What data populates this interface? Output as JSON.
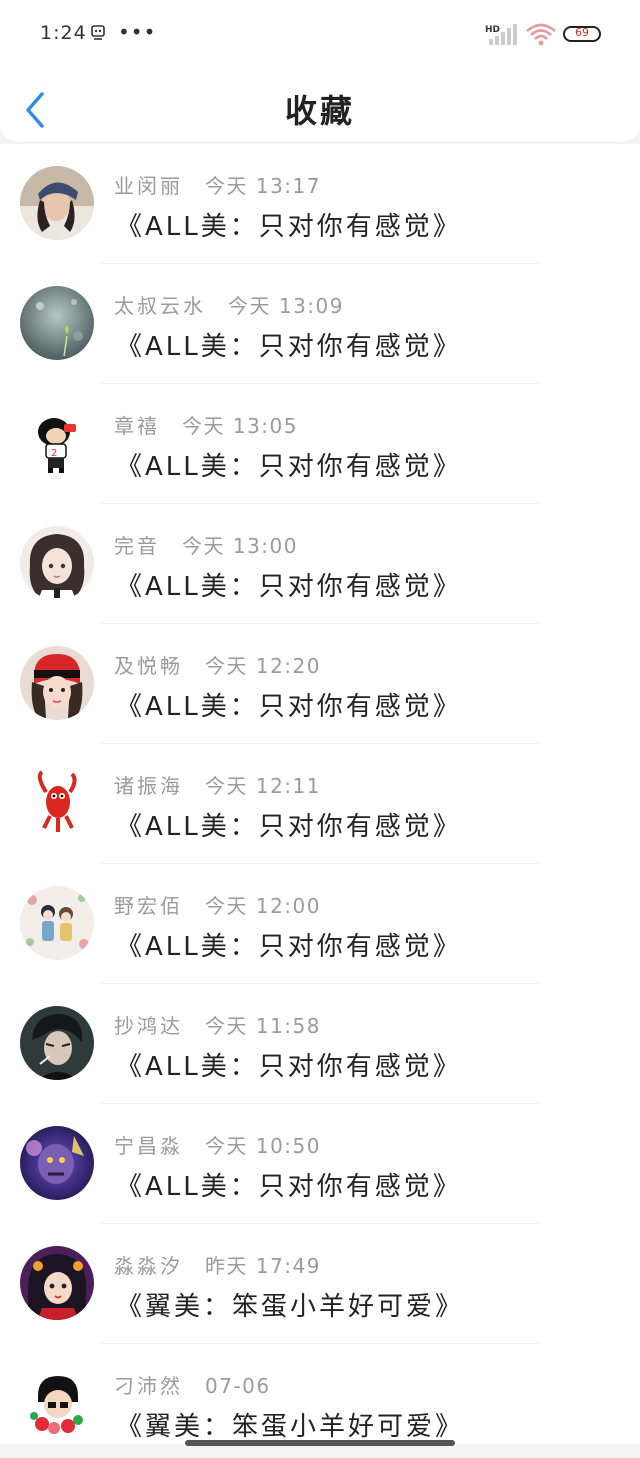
{
  "status_bar": {
    "time": "1:24",
    "dots": "•••",
    "hd_label": "HD",
    "battery": "69",
    "accent_wifi": "#e89a9a"
  },
  "header": {
    "title": "收藏",
    "back_icon": "chevron-left-icon",
    "back_color": "#2a8cf0"
  },
  "favorites": [
    {
      "name": "业闵丽",
      "time": "今天 13:17",
      "content": "《ALL美：只对你有感觉》",
      "avatar": "photo-girl-cap"
    },
    {
      "name": "太叔云水",
      "time": "今天 13:09",
      "content": "《ALL美：只对你有感觉》",
      "avatar": "green-bokeh"
    },
    {
      "name": "章禧",
      "time": "今天 13:05",
      "content": "《ALL美：只对你有感觉》",
      "avatar": "cartoon-boy"
    },
    {
      "name": "完音",
      "time": "今天 13:00",
      "content": "《ALL美：只对你有感觉》",
      "avatar": "anime-girl"
    },
    {
      "name": "及悦畅",
      "time": "今天 12:20",
      "content": "《ALL美：只对你有感觉》",
      "avatar": "girl-red-cap"
    },
    {
      "name": "诸振海",
      "time": "今天 12:11",
      "content": "《ALL美：只对你有感觉》",
      "avatar": "red-crawfish"
    },
    {
      "name": "野宏佰",
      "time": "今天 12:00",
      "content": "《ALL美：只对你有感觉》",
      "avatar": "illustrated-couple"
    },
    {
      "name": "抄鸿达",
      "time": "今天 11:58",
      "content": "《ALL美：只对你有感觉》",
      "avatar": "anime-boy"
    },
    {
      "name": "宁昌淼",
      "time": "今天 10:50",
      "content": "《ALL美：只对你有感觉》",
      "avatar": "game-character"
    },
    {
      "name": "淼淼汐",
      "time": "昨天 17:49",
      "content": "《翼美：笨蛋小羊好可爱》",
      "avatar": "cartoon-dark-girl"
    },
    {
      "name": "刁沛然",
      "time": "07-06",
      "content": "《翼美：笨蛋小羊好可爱》",
      "avatar": "cartoon-flowers"
    }
  ]
}
